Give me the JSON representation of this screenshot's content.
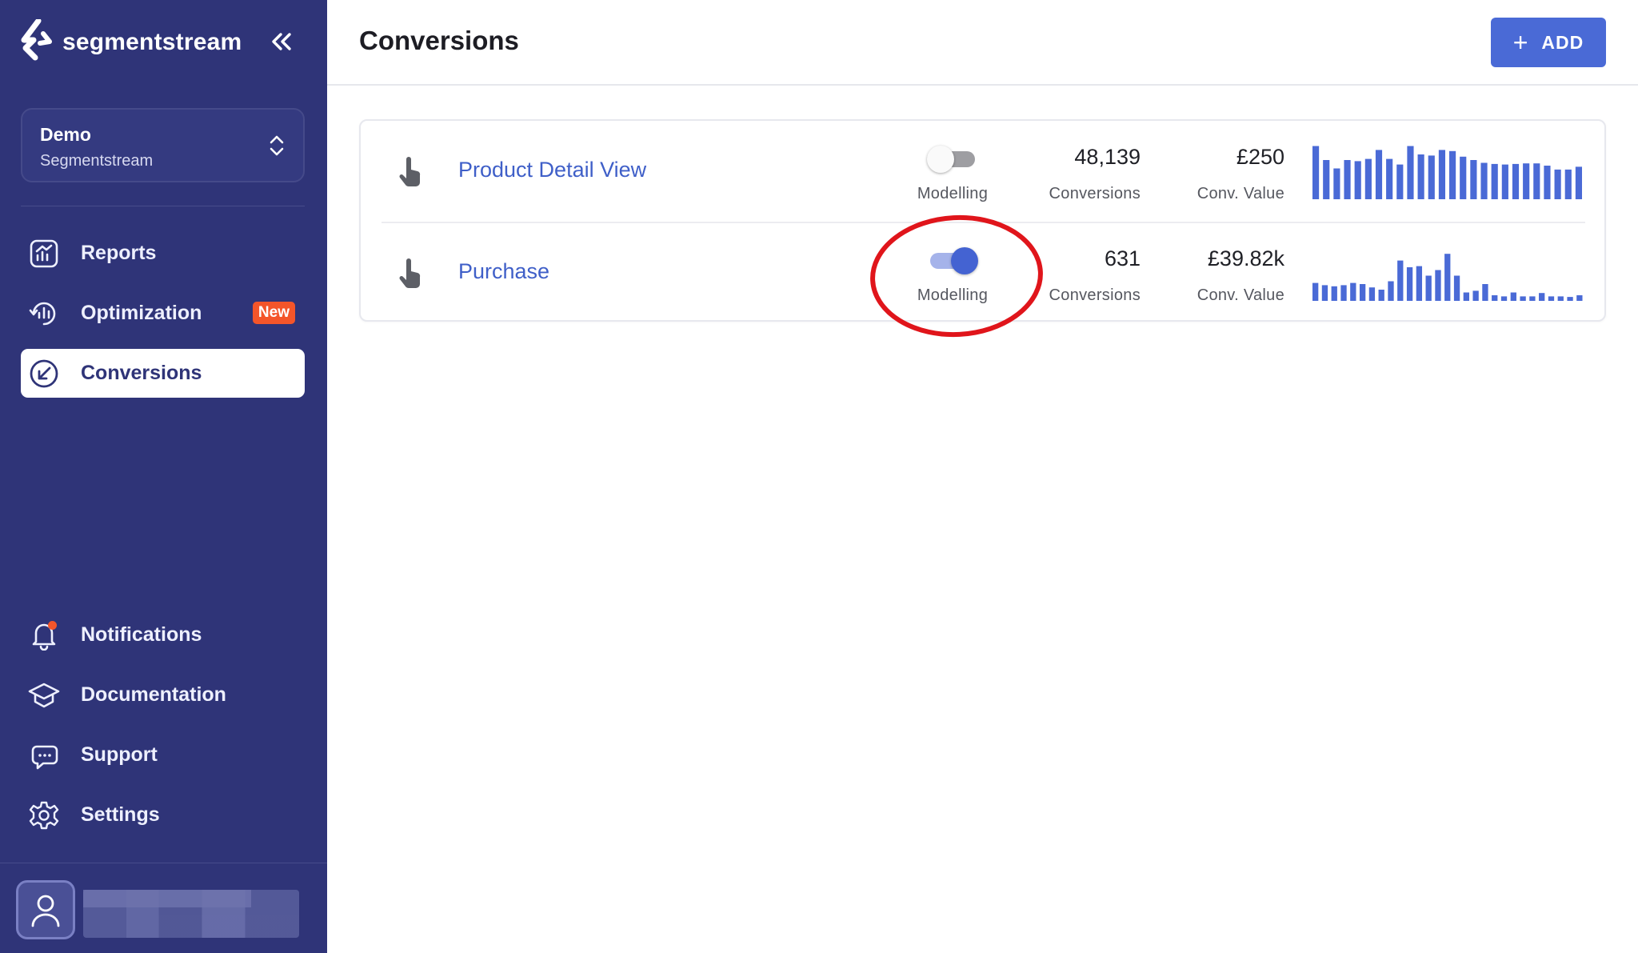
{
  "brand": {
    "name": "segmentstream"
  },
  "workspace": {
    "name": "Demo",
    "org": "Segmentstream"
  },
  "nav": {
    "reports": "Reports",
    "optimization": "Optimization",
    "optimization_badge": "New",
    "conversions": "Conversions",
    "notifications": "Notifications",
    "documentation": "Documentation",
    "support": "Support",
    "settings": "Settings"
  },
  "header": {
    "title": "Conversions",
    "add_label": "ADD"
  },
  "colors": {
    "sidebar": "#2f3478",
    "accent": "#4a6ad6",
    "badge": "#f4552a",
    "link": "#3f5fc8",
    "annotation": "#e0151b"
  },
  "conversions": [
    {
      "name": "Product Detail View",
      "modelling": false,
      "modelling_label": "Modelling",
      "conversions_value": "48,139",
      "conversions_label": "Conversions",
      "conv_value": "£250",
      "conv_value_label": "Conv. Value",
      "spark": [
        95,
        70,
        55,
        70,
        68,
        72,
        88,
        72,
        62,
        95,
        80,
        78,
        88,
        86,
        76,
        70,
        65,
        63,
        62,
        63,
        64,
        64,
        60,
        53,
        53,
        58
      ]
    },
    {
      "name": "Purchase",
      "modelling": true,
      "modelling_label": "Modelling",
      "conversions_value": "631",
      "conversions_label": "Conversions",
      "conv_value": "£39.82k",
      "conv_value_label": "Conv. Value",
      "spark": [
        32,
        28,
        26,
        28,
        32,
        30,
        24,
        20,
        35,
        72,
        60,
        62,
        45,
        55,
        84,
        45,
        15,
        18,
        30,
        10,
        8,
        15,
        8,
        8,
        14,
        8,
        8,
        7,
        10
      ]
    }
  ]
}
